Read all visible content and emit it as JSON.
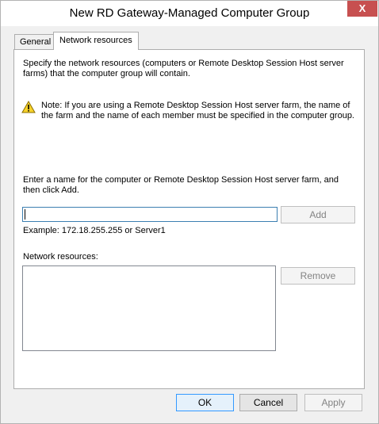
{
  "window": {
    "title": "New RD Gateway-Managed Computer Group",
    "close_label": "X"
  },
  "tabs": [
    {
      "label": "General",
      "active": false
    },
    {
      "label": "Network resources",
      "active": true
    }
  ],
  "panel": {
    "description": "Specify the network resources (computers or Remote Desktop Session Host server farms) that the computer group will contain.",
    "note": "Note: If you are using a Remote Desktop Session Host server farm, the name of the farm and the name of each member must be specified in the computer group.",
    "note_icon": "warning-icon",
    "enter_prompt": "Enter a name for the computer or Remote Desktop Session Host server farm, and then click Add.",
    "name_input": {
      "value": "",
      "placeholder": ""
    },
    "add_label": "Add",
    "example": "Example: 172.18.255.255 or Server1",
    "network_resources_label": "Network resources:",
    "network_resources": [],
    "remove_label": "Remove"
  },
  "footer": {
    "ok_label": "OK",
    "cancel_label": "Cancel",
    "apply_label": "Apply"
  },
  "colors": {
    "close_button": "#c75050",
    "warning_yellow": "#f7d22a",
    "focus_border": "#3c7fb1"
  }
}
